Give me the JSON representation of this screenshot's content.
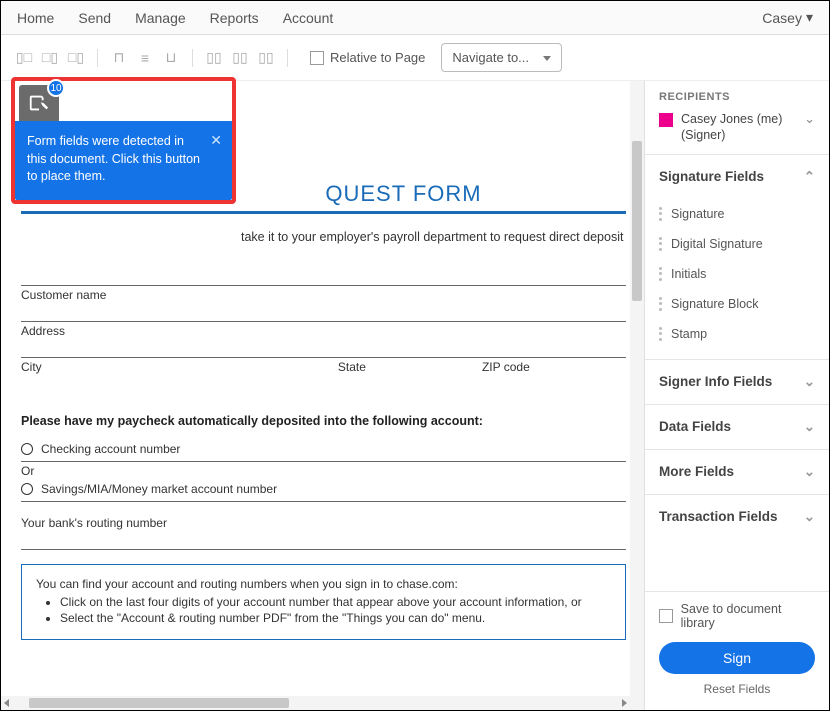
{
  "topnav": {
    "items": [
      "Home",
      "Send",
      "Manage",
      "Reports",
      "Account"
    ],
    "user": "Casey"
  },
  "toolbar": {
    "relative_label": "Relative to Page",
    "navigate_label": "Navigate to..."
  },
  "detect": {
    "badge": "10",
    "tip": "Form fields were detected in this document. Click this button to place them."
  },
  "doc": {
    "title_suffix": "QUEST FORM",
    "sub_suffix": "take it to your employer's payroll department to request direct deposit",
    "labels": {
      "customer": "Customer name",
      "address": "Address",
      "city": "City",
      "state": "State",
      "zip": "ZIP code"
    },
    "section": "Please have my paycheck automatically deposited into the following account:",
    "checking": "Checking account number",
    "or": "Or",
    "savings": "Savings/MIA/Money market account number",
    "routing": "Your bank's routing number",
    "info_lead": "You can find your account and routing numbers when you sign in to chase.com:",
    "info_b1": "Click on the last four digits of your account number that appear above your account information, or",
    "info_b2": "Select the \"Account & routing number PDF\" from the \"Things you can do\" menu."
  },
  "sidebar": {
    "recipients_title": "RECIPIENTS",
    "recipient_name": "Casey Jones (me)",
    "recipient_role": "(Signer)",
    "panels": {
      "signature": "Signature Fields",
      "signer": "Signer Info Fields",
      "data": "Data Fields",
      "more": "More Fields",
      "transaction": "Transaction Fields"
    },
    "sig_items": [
      "Signature",
      "Digital Signature",
      "Initials",
      "Signature Block",
      "Stamp"
    ],
    "save_label": "Save to document library",
    "sign_label": "Sign",
    "reset_label": "Reset Fields"
  }
}
